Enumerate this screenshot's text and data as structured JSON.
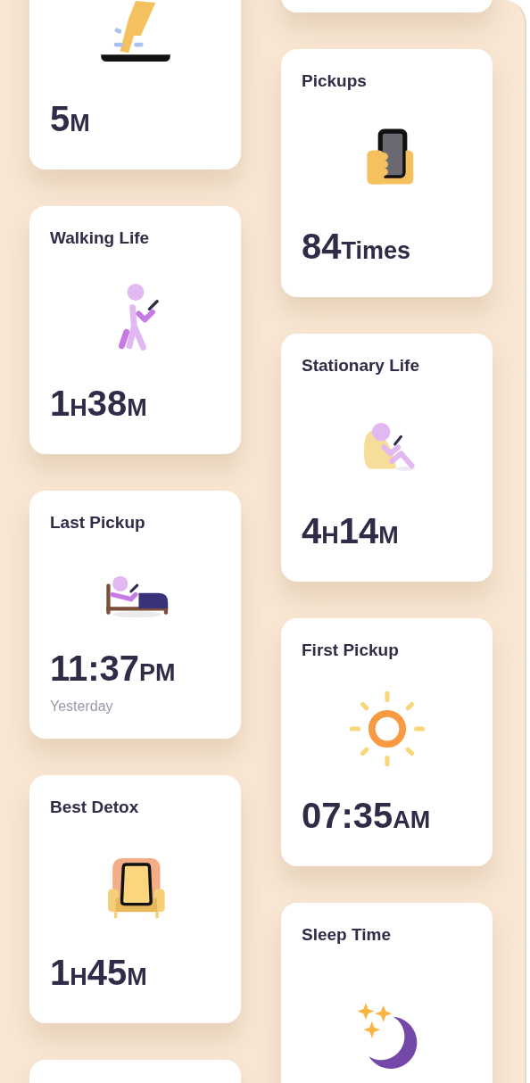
{
  "columns": [
    {
      "cards": [
        {
          "kind": "stat",
          "value": [
            {
              "number": "5",
              "unit": "M"
            }
          ]
        },
        {
          "kind": "stat",
          "title": "Walking Life",
          "value": [
            {
              "number": "1",
              "unit": "H"
            },
            {
              "number": "38",
              "unit": "M"
            }
          ]
        },
        {
          "kind": "stat",
          "title": "Last Pickup",
          "value": [
            {
              "number": "11:37",
              "unit": "PM"
            }
          ],
          "note": "Yesterday"
        },
        {
          "kind": "stat",
          "title": "Best Detox",
          "value": [
            {
              "number": "1",
              "unit": "H"
            },
            {
              "number": "45",
              "unit": "M"
            }
          ]
        },
        {
          "kind": "blank"
        }
      ]
    },
    {
      "cards": [
        {
          "kind": "blank"
        },
        {
          "kind": "stat",
          "title": "Pickups",
          "value": [
            {
              "number": "84",
              "unit": "Times"
            }
          ]
        },
        {
          "kind": "stat",
          "title": "Stationary Life",
          "value": [
            {
              "number": "4",
              "unit": "H"
            },
            {
              "number": "14",
              "unit": "M"
            }
          ]
        },
        {
          "kind": "stat",
          "title": "First Pickup",
          "value": [
            {
              "number": "07:35",
              "unit": "AM"
            }
          ]
        },
        {
          "kind": "stat",
          "title": "Sleep Time"
        }
      ]
    }
  ]
}
